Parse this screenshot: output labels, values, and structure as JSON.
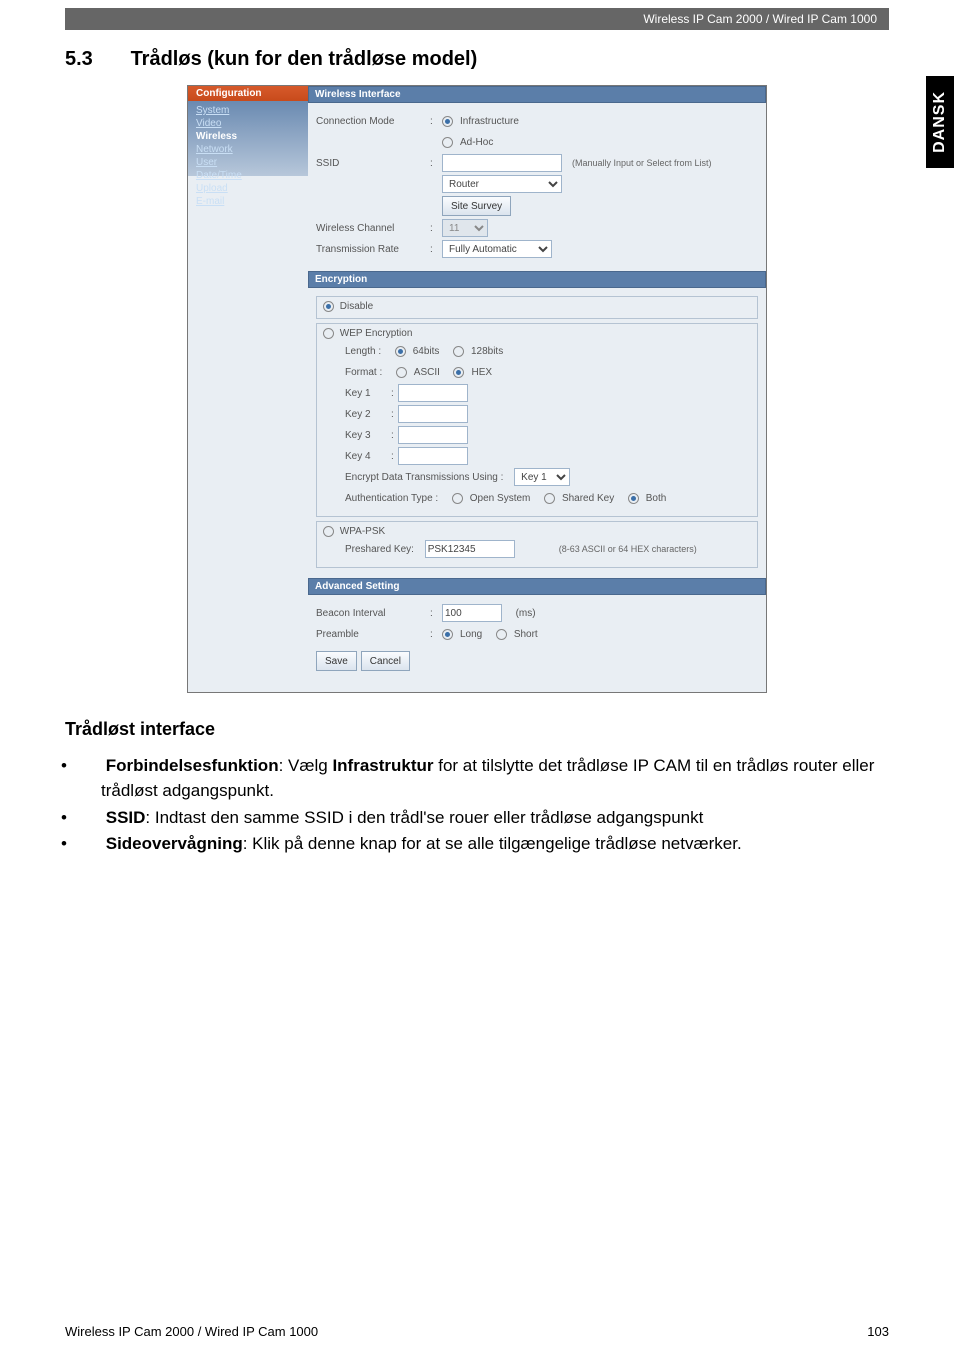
{
  "header": {
    "product_line": "Wireless IP Cam 2000 / Wired IP Cam 1000"
  },
  "side_tab": "DANSK",
  "section": {
    "number": "5.3",
    "title": "Trådløs (kun for den trådløse model)"
  },
  "config_panel": {
    "header": "Configuration",
    "sidebar": {
      "items": [
        "System",
        "Video",
        "Wireless",
        "Network",
        "User",
        "Date/Time",
        "Upload",
        "E-mail"
      ],
      "active": "Wireless"
    },
    "wireless_interface": {
      "panel_title": "Wireless Interface",
      "connection_mode": {
        "label": "Connection Mode",
        "options": [
          "Infrastructure",
          "Ad-Hoc"
        ],
        "selected": "Infrastructure"
      },
      "ssid": {
        "label": "SSID",
        "value": "",
        "hint": "(Manually Input or Select from List)",
        "router_select": "Router",
        "site_survey_btn": "Site Survey"
      },
      "wireless_channel": {
        "label": "Wireless Channel",
        "value": "11"
      },
      "transmission_rate": {
        "label": "Transmission Rate",
        "value": "Fully Automatic"
      }
    },
    "encryption": {
      "panel_title": "Encryption",
      "disable": {
        "label": "Disable",
        "selected": true
      },
      "wep": {
        "label": "WEP Encryption",
        "selected": false,
        "length": {
          "label": "Length :",
          "options": [
            "64bits",
            "128bits"
          ],
          "selected": "64bits"
        },
        "format": {
          "label": "Format :",
          "options": [
            "ASCII",
            "HEX"
          ],
          "selected": "HEX"
        },
        "keys": [
          {
            "label": "Key 1",
            "value": ""
          },
          {
            "label": "Key 2",
            "value": ""
          },
          {
            "label": "Key 3",
            "value": ""
          },
          {
            "label": "Key 4",
            "value": ""
          }
        ],
        "encrypt_using": {
          "label": "Encrypt Data Transmissions Using :",
          "value": "Key 1"
        },
        "auth_type": {
          "label": "Authentication Type :",
          "options": [
            "Open System",
            "Shared Key",
            "Both"
          ],
          "selected": "Both"
        }
      },
      "wpa": {
        "label": "WPA-PSK",
        "selected": false,
        "preshared": {
          "label": "Preshared Key:",
          "value": "PSK12345",
          "hint": "(8-63 ASCII or 64 HEX characters)"
        }
      }
    },
    "advanced": {
      "panel_title": "Advanced Setting",
      "beacon": {
        "label": "Beacon Interval",
        "value": "100",
        "unit": "(ms)"
      },
      "preamble": {
        "label": "Preamble",
        "options": [
          "Long",
          "Short"
        ],
        "selected": "Long"
      }
    },
    "buttons": {
      "save": "Save",
      "cancel": "Cancel"
    }
  },
  "body_text": {
    "heading": "Trådløst interface",
    "bullets": [
      {
        "term": "Forbindelsesfunktion",
        "sep": ": Vælg ",
        "bold2": "Infrastruktur",
        "rest": " for at tilslytte det trådløse IP CAM til en trådløs router eller trådløst adgangspunkt."
      },
      {
        "term": "SSID",
        "sep": ": Indtast den samme SSID i den trådl'se rouer eller trådløse adgangspunkt",
        "bold2": "",
        "rest": ""
      },
      {
        "term": "Sideovervågning",
        "sep": ": Klik på denne knap for at se alle tilgængelige trådløse netværker.",
        "bold2": "",
        "rest": ""
      }
    ]
  },
  "footer": {
    "left": "Wireless IP Cam 2000 / Wired IP Cam 1000",
    "right": "103"
  }
}
